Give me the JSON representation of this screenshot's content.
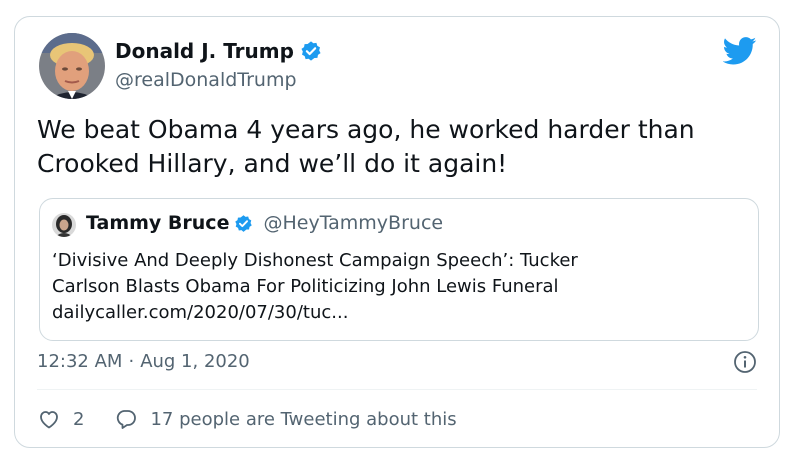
{
  "author": {
    "name": "Donald J. Trump",
    "handle": "@realDonaldTrump"
  },
  "tweet_text": "We beat Obama 4 years ago, he worked harder than Crooked Hillary, and we’ll do it again!",
  "quoted": {
    "name": "Tammy Bruce",
    "handle": "@HeyTammyBruce",
    "text_line1": "‘Divisive And Deeply Dishonest Campaign Speech’: Tucker",
    "text_line2": "Carlson Blasts Obama For Politicizing John Lewis Funeral",
    "link": "dailycaller.com/2020/07/30/tuc..."
  },
  "meta": {
    "time": "12:32 AM",
    "separator": "·",
    "date": "Aug 1, 2020"
  },
  "actions": {
    "like_count": "2",
    "retweet_text": "17 people are Tweeting about this"
  },
  "icons": {
    "verified": "verified-badge-icon",
    "brand": "twitter-bird-icon",
    "info": "info-icon",
    "like": "heart-icon",
    "reply": "speech-bubble-icon"
  },
  "colors": {
    "brand": "#1d9bf0",
    "text": "#0f1419",
    "secondary": "#536471",
    "border": "#cfd9de"
  }
}
